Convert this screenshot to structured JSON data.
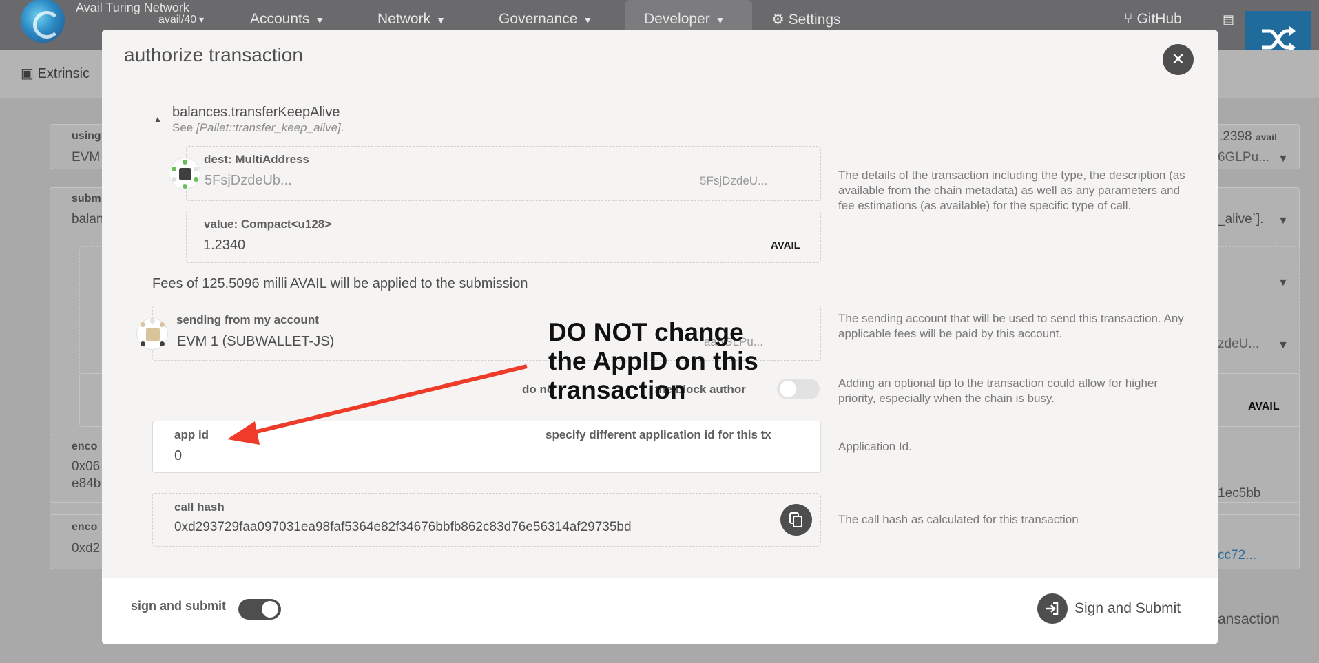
{
  "app": {
    "chain_name": "Avail Turing Network",
    "chain_version": "avail/40",
    "nav": [
      "Accounts",
      "Network",
      "Governance",
      "Developer"
    ],
    "settings_label": "Settings",
    "github_label": "GitHub",
    "subnav_label": "Extrinsic"
  },
  "background": {
    "using_label": "using",
    "using_value": "EVM",
    "balance_right": ".2398",
    "balance_unit": "avail",
    "address_right": "6GLPu...",
    "submission_label": "subm",
    "submission_value": "balan",
    "doc_right": "_alive`].",
    "dest_right": "zdeU...",
    "avail_unit": "AVAIL",
    "encoded_label_1": "enco",
    "encoded_value_1a": "0x06",
    "encoded_value_1b": "e84b",
    "encoded_right_1": "1ec5bb",
    "encoded_label_2": "enco",
    "encoded_value_2": "0xd2",
    "encoded_right_2": "cc72...",
    "submit_right": "ansaction"
  },
  "modal": {
    "title": "authorize transaction",
    "call": {
      "name": "balances.transferKeepAlive",
      "doc_prefix": "See ",
      "doc_ref": "[Pallet::transfer_keep_alive]",
      "doc_suffix": "."
    },
    "dest": {
      "label": "dest: MultiAddress",
      "value": "5FsjDzdeUb...",
      "value_right": "5FsjDzdeU..."
    },
    "amount": {
      "label": "value: Compact<u128>",
      "value": "1.2340",
      "unit": "AVAIL"
    },
    "call_help": "The details of the transaction including the type, the description (as available from the chain metadata) as well as any parameters and fee estimations (as available) for the specific type of call.",
    "fees_text": "Fees of 125.5096 milli AVAIL will be applied to the submission",
    "sender": {
      "label": "sending from my account",
      "value": "EVM 1 (SUBWALLET-JS)",
      "address_right": "6GLPu...",
      "address_right_prefix": "aa",
      "help": "The sending account that will be used to send this transaction. Any applicable fees will be paid by this account."
    },
    "tip": {
      "label_start": "do no",
      "label_end": "the block author",
      "help": "Adding an optional tip to the transaction could allow for higher priority, especially when the chain is busy."
    },
    "app_id": {
      "label": "app id",
      "hint": "specify different application id for this tx",
      "value": "0",
      "help": "Application Id."
    },
    "call_hash": {
      "label": "call hash",
      "value": "0xd293729faa097031ea98faf5364e82f34676bbfb862c83d76e56314af29735bd",
      "help": "The call hash as calculated for this transaction"
    },
    "footer": {
      "sign_toggle_label": "sign and submit",
      "submit_label": "Sign and Submit"
    }
  },
  "annotation": {
    "text": "DO NOT change the AppID on this transaction"
  },
  "colors": {
    "accent_dark": "#4e4e4e",
    "annotation_arrow": "#ee3b2a",
    "shuffle_button": "#1f6c9c"
  }
}
